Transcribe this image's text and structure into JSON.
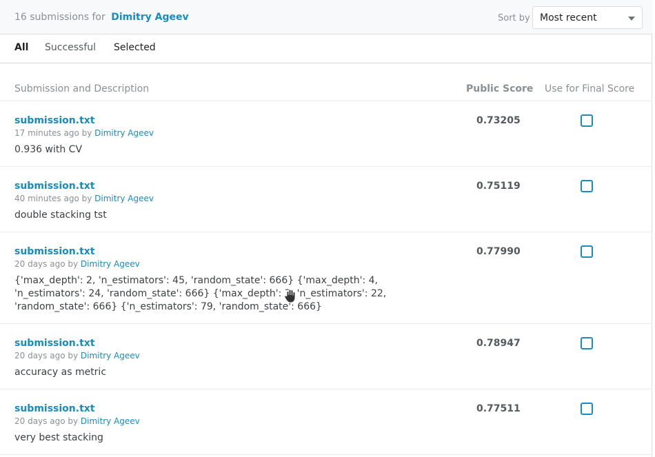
{
  "header": {
    "count_text": "16 submissions for",
    "user_name": "Dimitry Ageev",
    "sort_label": "Sort by",
    "sort_value": "Most recent"
  },
  "tabs": [
    {
      "label": "All"
    },
    {
      "label": "Successful"
    },
    {
      "label": "Selected"
    }
  ],
  "columns": {
    "submission": "Submission and Description",
    "public_score": "Public Score",
    "final": "Use for Final Score"
  },
  "submissions": [
    {
      "file": "submission.txt",
      "time": "17 minutes ago by",
      "author": "Dimitry Ageev",
      "desc": "0.936 with CV",
      "score": "0.73205"
    },
    {
      "file": "submission.txt",
      "time": "40 minutes ago by",
      "author": "Dimitry Ageev",
      "desc": "double stacking tst",
      "score": "0.75119"
    },
    {
      "file": "submission.txt",
      "time": "20 days ago by",
      "author": "Dimitry Ageev",
      "desc": "{'max_depth': 2, 'n_estimators': 45, 'random_state': 666} {'max_depth': 4, 'n_estimators': 24, 'random_state': 666} {'max_depth': 3, 'n_estimators': 22, 'random_state': 666} {'n_estimators': 79, 'random_state': 666}",
      "score": "0.77990"
    },
    {
      "file": "submission.txt",
      "time": "20 days ago by",
      "author": "Dimitry Ageev",
      "desc": "accuracy as metric",
      "score": "0.78947"
    },
    {
      "file": "submission.txt",
      "time": "20 days ago by",
      "author": "Dimitry Ageev",
      "desc": "very best stacking",
      "score": "0.77511"
    }
  ],
  "colors": {
    "link": "#1a8bbf",
    "muted": "#8a8f94"
  }
}
